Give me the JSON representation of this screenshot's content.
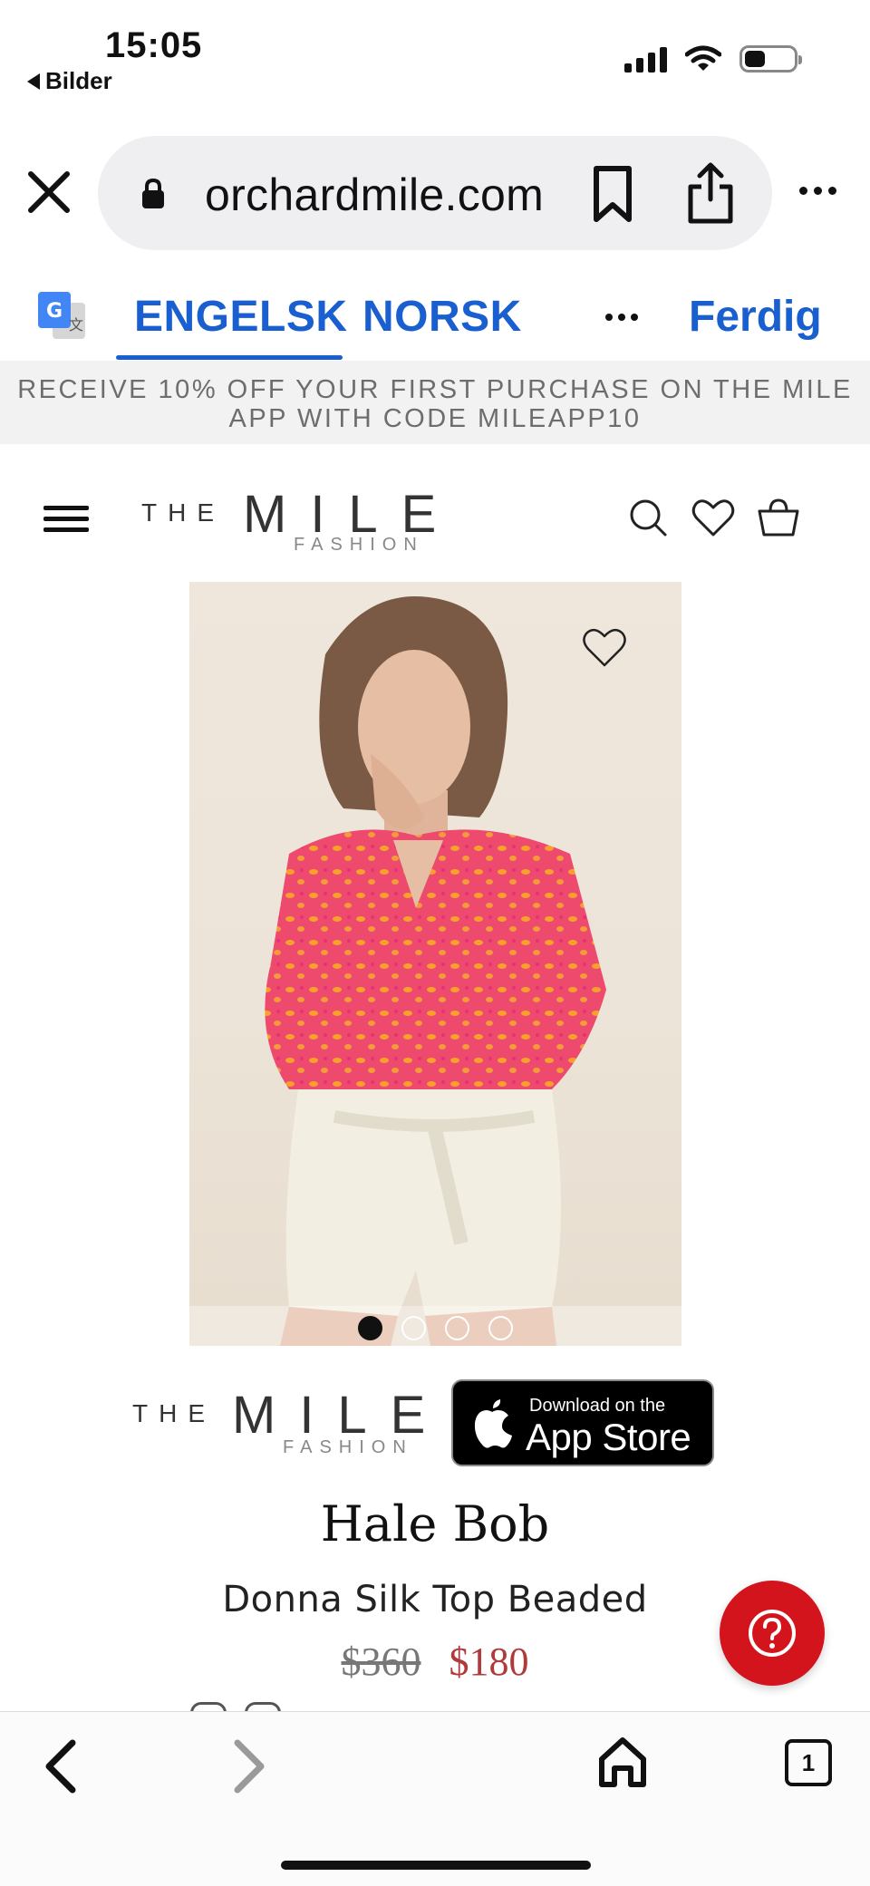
{
  "status_bar": {
    "time": "15:05",
    "back_app": "Bilder"
  },
  "browser": {
    "url": "orchardmile.com",
    "icons": {
      "close": "close-icon",
      "lock": "lock-icon",
      "bookmark": "bookmark-icon",
      "share": "share-icon",
      "more": "more-icon"
    }
  },
  "translate": {
    "tabs": [
      {
        "label": "ENGELSK",
        "active": true
      },
      {
        "label": "NORSK",
        "active": false
      }
    ],
    "done_label": "Ferdig"
  },
  "promo": {
    "line1": "RECEIVE 10% OFF YOUR FIRST PURCHASE ON THE MILE",
    "line2": "APP WITH CODE MILEAPP10"
  },
  "logo": {
    "the": "THE",
    "mile": "MILE",
    "fashion": "FASHION"
  },
  "carousel": {
    "count": 4,
    "active_index": 0
  },
  "app_badge": {
    "small": "Download on the",
    "big": "App Store"
  },
  "product": {
    "brand": "Hale Bob",
    "name": "Donna Silk Top Beaded",
    "price_original": "$360",
    "price_sale": "$180"
  },
  "bottom_nav": {
    "tab_count": "1"
  },
  "colors": {
    "accent_blue": "#1a5fd0",
    "sale_red": "#b03a3a",
    "help_red": "#d3141c"
  }
}
